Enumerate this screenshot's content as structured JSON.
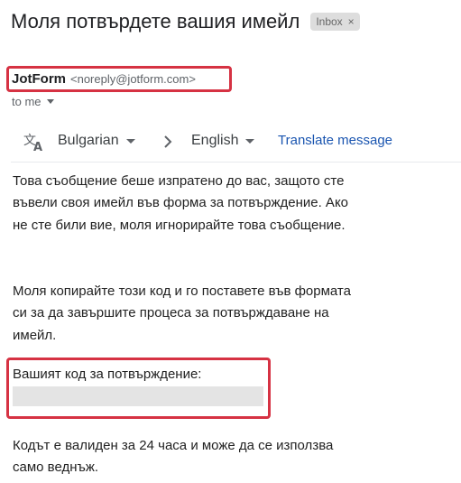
{
  "email": {
    "subject": "Моля потвърдете вашия имейл",
    "label_chip": "Inbox",
    "label_chip_close": "×",
    "sender": {
      "name": "JotForm",
      "email": "<noreply@jotform.com>"
    },
    "recipient": "to me"
  },
  "translate_bar": {
    "icon": "translate-icon",
    "source_language": "Bulgarian",
    "target_language": "English",
    "action_label": "Translate message"
  },
  "body": {
    "paragraph1": "Това съобщение беше изпратено до вас, защото сте въвели своя имейл във форма за потвърждение. Ако не сте били вие, моля игнорирайте това съобщение.",
    "paragraph2": "Моля копирайте този код и го поставете във формата си за да завършите процеса за потвърждаване на имейл.",
    "code_label": "Вашият код за потвърждение:",
    "paragraph3": "Кодът е валиден за 24 часа и може да се използва само веднъж."
  },
  "colors": {
    "highlight_border": "#d63243",
    "link": "#1a55b0",
    "redaction": "#e4e4e4"
  }
}
